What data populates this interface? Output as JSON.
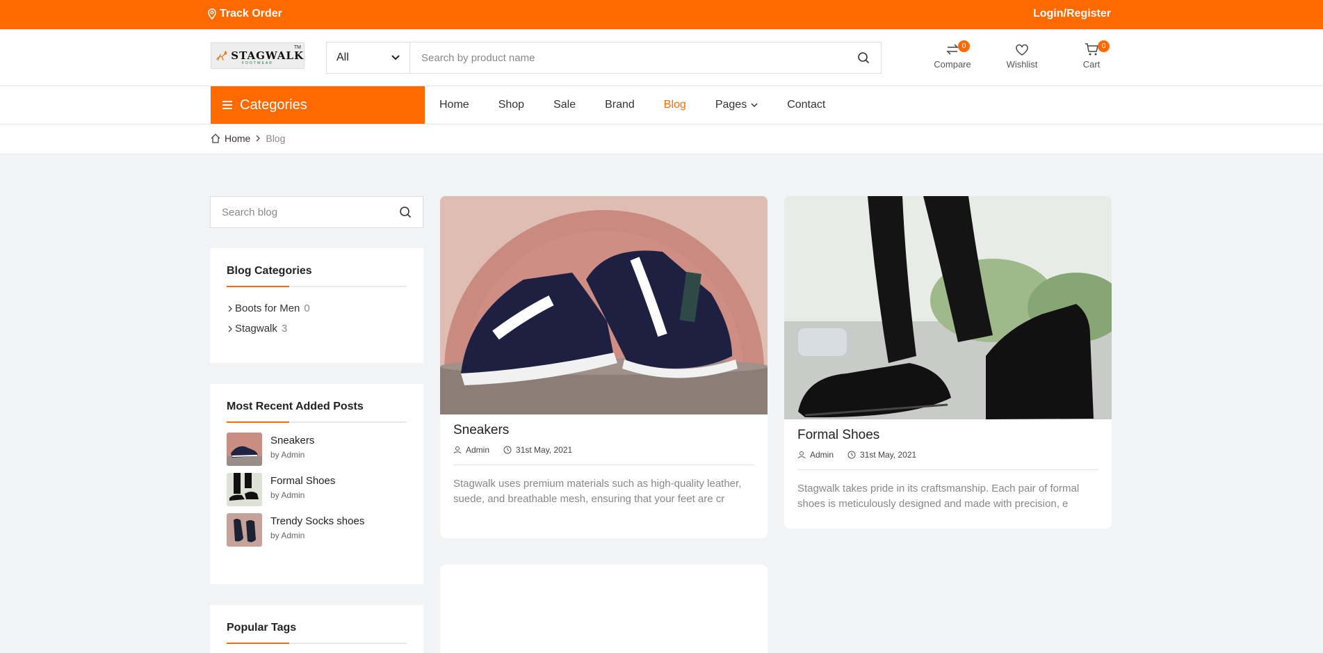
{
  "topbar": {
    "track_label": "Track Order",
    "login_label": "Login/Register"
  },
  "header": {
    "logo_text": "STAGWALK",
    "logo_sub": "FOOTWEAR",
    "logo_tm": "TM",
    "search_category": "All",
    "search_placeholder": "Search by product name",
    "compare_label": "Compare",
    "compare_count": "0",
    "wishlist_label": "Wishlist",
    "cart_label": "Cart",
    "cart_count": "0"
  },
  "nav": {
    "categories_label": "Categories",
    "items": [
      "Home",
      "Shop",
      "Sale",
      "Brand",
      "Blog",
      "Pages",
      "Contact"
    ],
    "active": "Blog"
  },
  "breadcrumb": {
    "home": "Home",
    "current": "Blog"
  },
  "sidebar": {
    "search_placeholder": "Search blog",
    "categories_title": "Blog Categories",
    "categories": [
      {
        "name": "Boots for Men",
        "count": "0"
      },
      {
        "name": "Stagwalk",
        "count": "3"
      }
    ],
    "recent_title": "Most Recent Added Posts",
    "recent": [
      {
        "title": "Sneakers",
        "by": "by Admin"
      },
      {
        "title": "Formal Shoes",
        "by": "by Admin"
      },
      {
        "title": "Trendy Socks shoes",
        "by": "by Admin"
      }
    ],
    "tags_title": "Popular Tags"
  },
  "posts": [
    {
      "title": "Sneakers",
      "author": "Admin",
      "date": "31st May, 2021",
      "excerpt": "Stagwalk uses premium materials such as high-quality leather, suede, and breathable mesh, ensuring that your feet are cr"
    },
    {
      "title": "Formal Shoes",
      "author": "Admin",
      "date": "31st May, 2021",
      "excerpt": "Stagwalk takes pride in its craftsmanship. Each pair of formal shoes is meticulously designed and made with precision, e"
    }
  ],
  "colors": {
    "accent": "#ff6a00"
  }
}
